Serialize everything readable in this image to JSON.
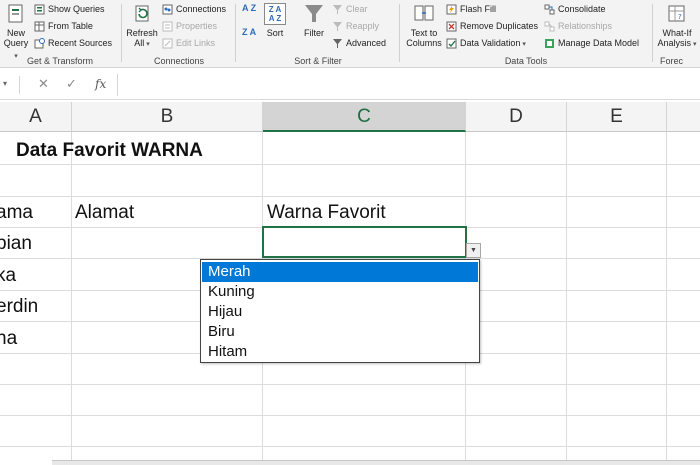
{
  "ribbon": {
    "get_transform": {
      "group_label": "Get & Transform",
      "new_query": [
        "New",
        "Query"
      ],
      "show_queries": "Show Queries",
      "from_table": "From Table",
      "recent_sources": "Recent Sources"
    },
    "connections": {
      "group_label": "Connections",
      "refresh_all": [
        "Refresh",
        "All"
      ],
      "connections": "Connections",
      "properties": "Properties",
      "edit_links": "Edit Links"
    },
    "sort_filter": {
      "group_label": "Sort & Filter",
      "sort_az": "A Z",
      "sort_za": "Z A",
      "sort_box_top": "Z A",
      "sort_box_bottom": "A Z",
      "sort": "Sort",
      "filter": "Filter",
      "clear": "Clear",
      "reapply": "Reapply",
      "advanced": "Advanced"
    },
    "data_tools": {
      "group_label": "Data Tools",
      "text_to_columns": [
        "Text to",
        "Columns"
      ],
      "flash_fill": "Flash Fill",
      "remove_duplicates": "Remove Duplicates",
      "data_validation": "Data Validation",
      "consolidate": "Consolidate",
      "relationships": "Relationships",
      "manage_data_model": "Manage Data Model"
    },
    "forecast": {
      "group_label": "Forec",
      "what_if": [
        "What-If",
        "Analysis"
      ]
    }
  },
  "formula_bar": {
    "cancel": "✕",
    "enter": "✓",
    "fx": "fx",
    "content": ""
  },
  "columns": [
    "A",
    "B",
    "C",
    "D",
    "E"
  ],
  "cells": {
    "title": "Data Favorit WARNA",
    "header_name": "ama",
    "header_address": "Alamat",
    "header_color": "Warna Favorit",
    "names": [
      "bian",
      "ka",
      "erdin",
      "na"
    ]
  },
  "dropdown": {
    "options": [
      "Merah",
      "Kuning",
      "Hijau",
      "Biru",
      "Hitam"
    ],
    "highlighted": "Merah"
  },
  "colors": {
    "accent_green": "#217346",
    "highlight_blue": "#0078d7"
  }
}
